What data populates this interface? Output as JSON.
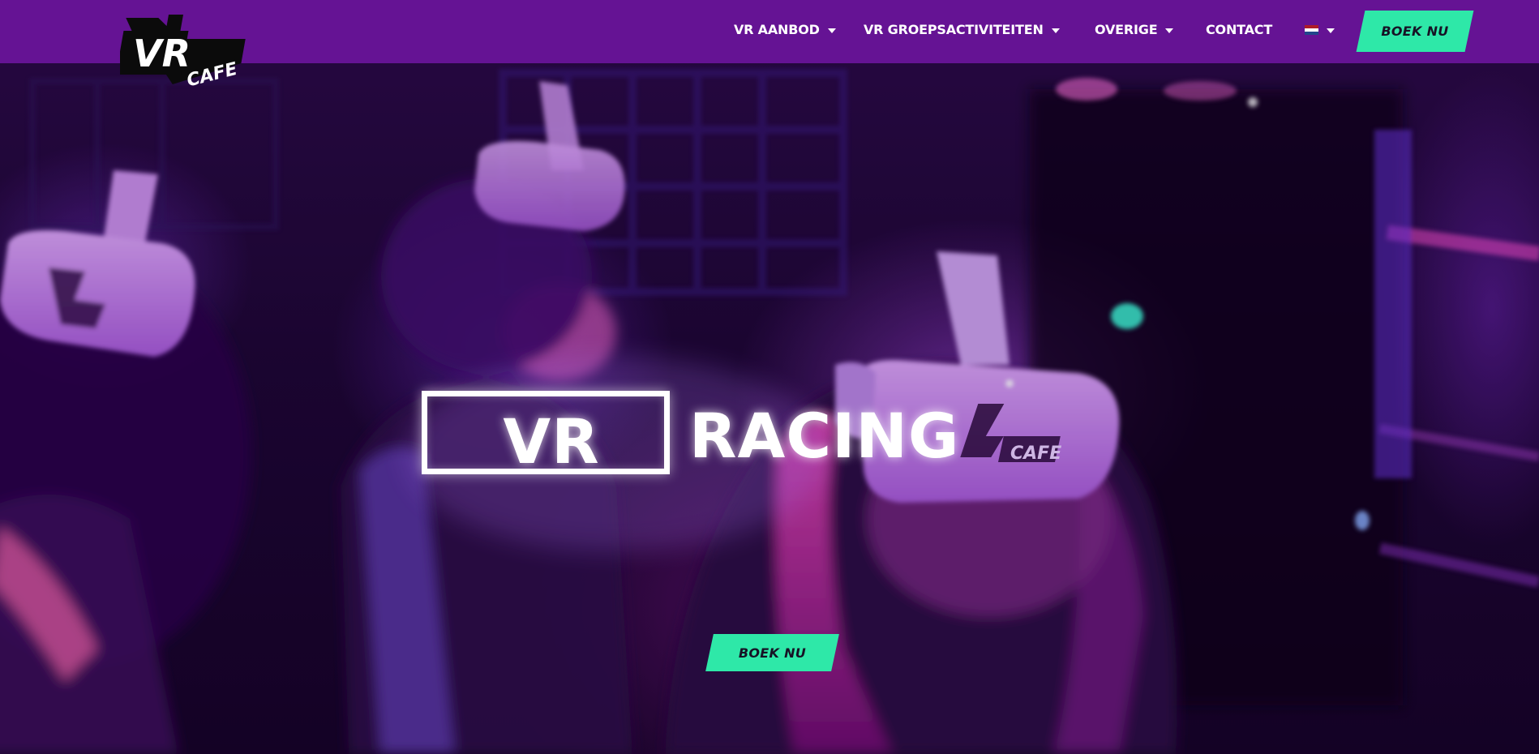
{
  "brand": {
    "logo_top": "VR",
    "logo_bottom": "CAFE"
  },
  "nav": {
    "items": [
      {
        "label": "VR AANBOD",
        "has_dropdown": true
      },
      {
        "label": "VR GROEPSACTIVITEITEN",
        "has_dropdown": true
      },
      {
        "label": "OVERIGE",
        "has_dropdown": true
      },
      {
        "label": "CONTACT",
        "has_dropdown": false
      }
    ],
    "language_flag": "flag-nl-icon",
    "cta_label": "BOEK NU"
  },
  "hero": {
    "title_boxed": "VR",
    "title_main": "RACING",
    "cta_label": "BOEK NU",
    "headset_logo": "CAFE"
  },
  "colors": {
    "nav_bg": "#651394",
    "cta_bg": "#2ee8a8",
    "cta_text": "#171225",
    "flag_red": "#ae1c28",
    "flag_white": "#ffffff",
    "flag_blue": "#21468b"
  }
}
